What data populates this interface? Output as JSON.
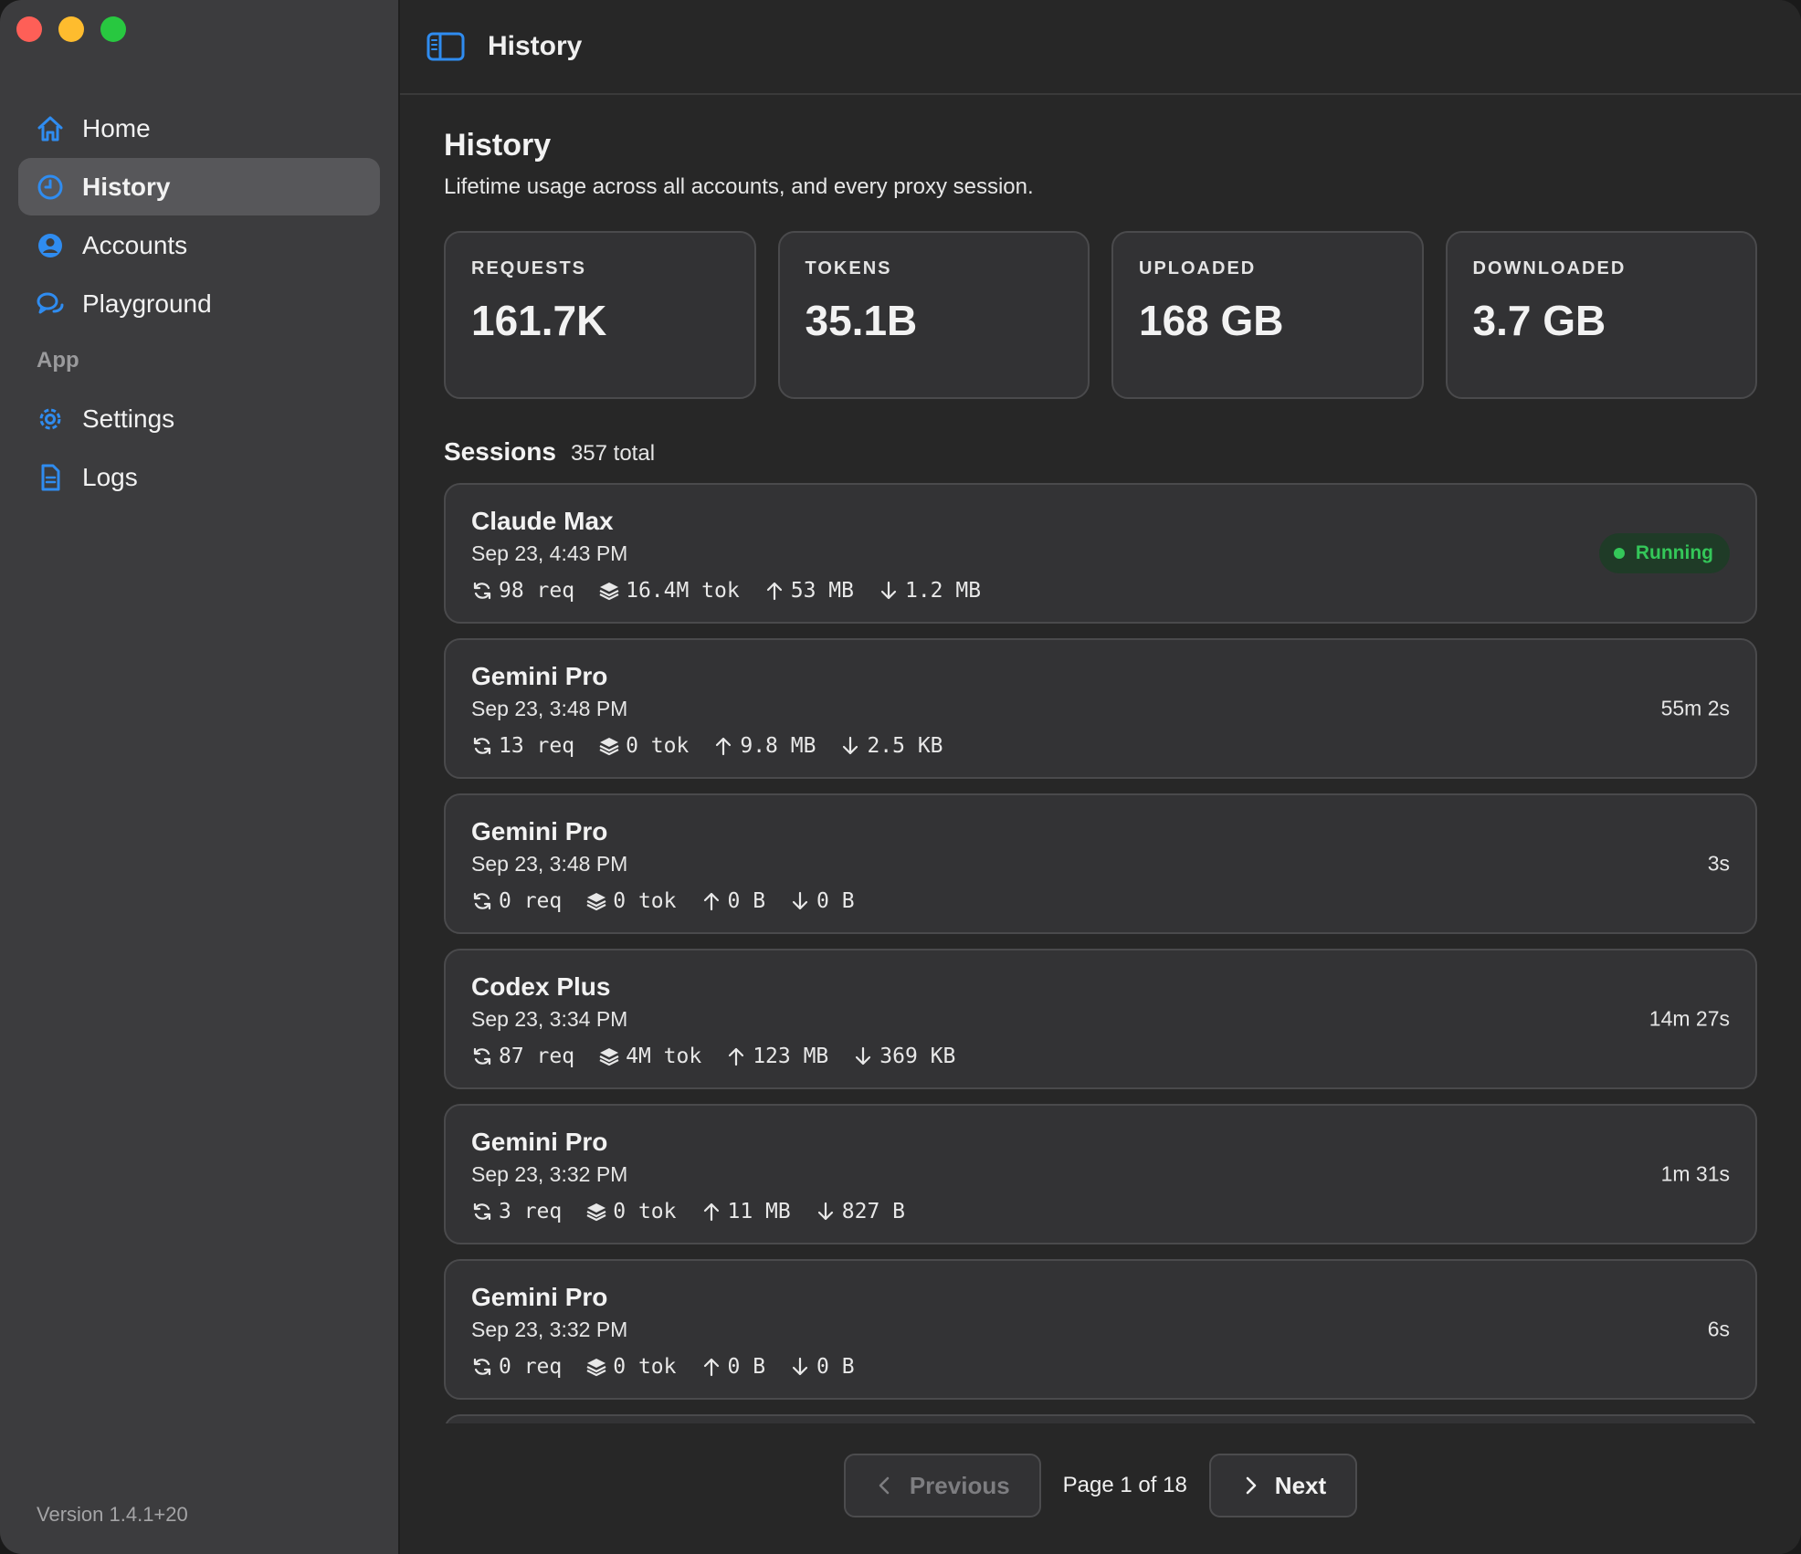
{
  "window": {
    "title": "History"
  },
  "sidebar": {
    "items": [
      {
        "label": "Home",
        "icon": "house-icon"
      },
      {
        "label": "History",
        "icon": "clock-icon",
        "active": true
      },
      {
        "label": "Accounts",
        "icon": "person-circle-icon"
      },
      {
        "label": "Playground",
        "icon": "chat-bubbles-icon"
      }
    ],
    "section_label": "App",
    "app_items": [
      {
        "label": "Settings",
        "icon": "gear-icon"
      },
      {
        "label": "Logs",
        "icon": "document-icon"
      }
    ],
    "version": "Version 1.4.1+20"
  },
  "header": {
    "title": "History",
    "subtitle": "Lifetime usage across all accounts, and every proxy session."
  },
  "stats": [
    {
      "label": "REQUESTS",
      "value": "161.7K"
    },
    {
      "label": "TOKENS",
      "value": "35.1B"
    },
    {
      "label": "UPLOADED",
      "value": "168 GB"
    },
    {
      "label": "DOWNLOADED",
      "value": "3.7 GB"
    }
  ],
  "sessions": {
    "title": "Sessions",
    "count": "357 total",
    "items": [
      {
        "name": "Claude Max",
        "date": "Sep 23, 4:43 PM",
        "req": "98 req",
        "tok": "16.4M tok",
        "up": "53 MB",
        "down": "1.2 MB",
        "status": "Running"
      },
      {
        "name": "Gemini Pro",
        "date": "Sep 23, 3:48 PM",
        "req": "13 req",
        "tok": "0 tok",
        "up": "9.8 MB",
        "down": "2.5 KB",
        "duration": "55m 2s"
      },
      {
        "name": "Gemini Pro",
        "date": "Sep 23, 3:48 PM",
        "req": "0 req",
        "tok": "0 tok",
        "up": "0 B",
        "down": "0 B",
        "duration": "3s"
      },
      {
        "name": "Codex Plus",
        "date": "Sep 23, 3:34 PM",
        "req": "87 req",
        "tok": "4M tok",
        "up": "123 MB",
        "down": "369 KB",
        "duration": "14m 27s"
      },
      {
        "name": "Gemini Pro",
        "date": "Sep 23, 3:32 PM",
        "req": "3 req",
        "tok": "0 tok",
        "up": "11 MB",
        "down": "827 B",
        "duration": "1m 31s"
      },
      {
        "name": "Gemini Pro",
        "date": "Sep 23, 3:32 PM",
        "req": "0 req",
        "tok": "0 tok",
        "up": "0 B",
        "down": "0 B",
        "duration": "6s"
      }
    ]
  },
  "pager": {
    "previous_label": "Previous",
    "next_label": "Next",
    "page_info": "Page 1 of 18"
  },
  "colors": {
    "accent": "#2f8cf0",
    "running": "#34c759",
    "sidebar_bg": "#3c3c3e",
    "content_bg": "#272727",
    "card_bg": "#333335"
  }
}
